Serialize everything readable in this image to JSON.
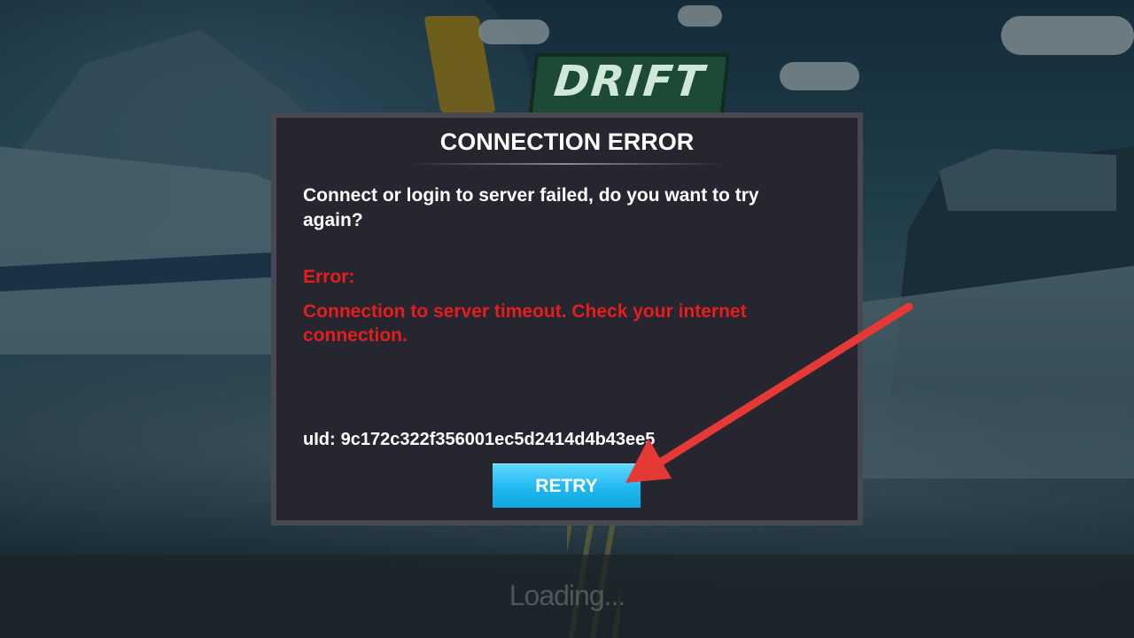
{
  "game": {
    "logo_text": "DRIFT",
    "loading_text": "Loading..."
  },
  "dialog": {
    "title": "CONNECTION ERROR",
    "message": "Connect or login to server failed, do you want to try again?",
    "error_label": "Error:",
    "error_message": "Connection to server timeout. Check your internet connection.",
    "uid_label": "uId:",
    "uid_value": "9c172c322f356001ec5d2414d4b43ee5",
    "retry_label": "RETRY"
  },
  "colors": {
    "dialog_bg": "#25262f",
    "dialog_border": "#474851",
    "error_text": "#e51d1d",
    "button_accent": "#1fb8ef",
    "annotation_arrow": "#e53935"
  }
}
